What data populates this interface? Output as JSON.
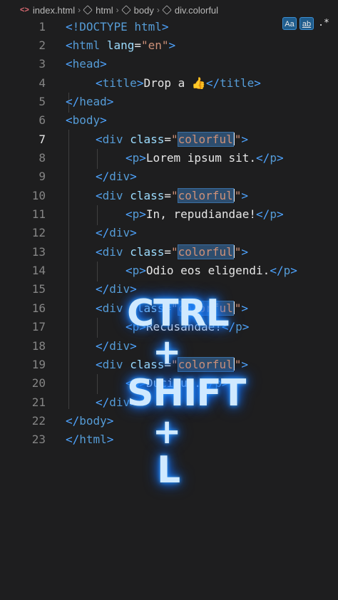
{
  "breadcrumb": {
    "items": [
      {
        "icon": "html-file-icon",
        "label": "index.html"
      },
      {
        "icon": "element-cube-icon",
        "label": "html"
      },
      {
        "icon": "element-cube-icon",
        "label": "body"
      },
      {
        "icon": "element-cube-icon",
        "label": "div.colorful"
      }
    ]
  },
  "find_options": {
    "match_case": "Aa",
    "match_whole_word": "ab",
    "use_regex": ".*"
  },
  "editor": {
    "active_line": 7,
    "line_numbers": [
      "1",
      "2",
      "3",
      "4",
      "5",
      "6",
      "7",
      "8",
      "9",
      "10",
      "11",
      "12",
      "13",
      "14",
      "15",
      "16",
      "17",
      "18",
      "19",
      "20",
      "21",
      "22",
      "23"
    ],
    "lines": {
      "l1": {
        "doctype": "!DOCTYPE",
        "html": "html"
      },
      "l2": {
        "tag": "html",
        "attr": "lang",
        "value": "\"en\""
      },
      "l3": {
        "tag": "head"
      },
      "l4": {
        "tag": "title",
        "text": "Drop a 👍",
        "close": "title"
      },
      "l5": {
        "tag": "head"
      },
      "l6": {
        "tag": "body"
      },
      "l7": {
        "tag": "div",
        "attr": "class",
        "value": "colorful"
      },
      "l8": {
        "tag": "p",
        "text": "Lorem ipsum sit."
      },
      "l9": {
        "tag": "div"
      },
      "l10": {
        "tag": "div",
        "attr": "class",
        "value": "colorful"
      },
      "l11": {
        "tag": "p",
        "text": "In, repudiandae!"
      },
      "l12": {
        "tag": "div"
      },
      "l13": {
        "tag": "div",
        "attr": "class",
        "value": "colorful"
      },
      "l14": {
        "tag": "p",
        "text": "Odio eos eligendi."
      },
      "l15": {
        "tag": "div"
      },
      "l16": {
        "tag": "div",
        "attr": "class",
        "value": "colorful"
      },
      "l17": {
        "tag": "p",
        "text": "Recusandae!"
      },
      "l18": {
        "tag": "div"
      },
      "l19": {
        "tag": "div",
        "attr": "class",
        "value": "colorful"
      },
      "l20": {
        "tag": "p",
        "text": "Ducimus."
      },
      "l21": {
        "tag": "div"
      },
      "l22": {
        "tag": "body"
      },
      "l23": {
        "tag": "html"
      }
    }
  },
  "overlay": {
    "line1": "CTRL",
    "plus1": "+",
    "line2": "SHIFT",
    "plus2": "+",
    "line3": "L"
  },
  "colors": {
    "background": "#1e1e1f",
    "tag": "#569cd6",
    "attribute": "#9cdcfe",
    "string": "#ce9178",
    "selection_highlight": "#2d4d6e",
    "glow": "#1a7dff"
  }
}
